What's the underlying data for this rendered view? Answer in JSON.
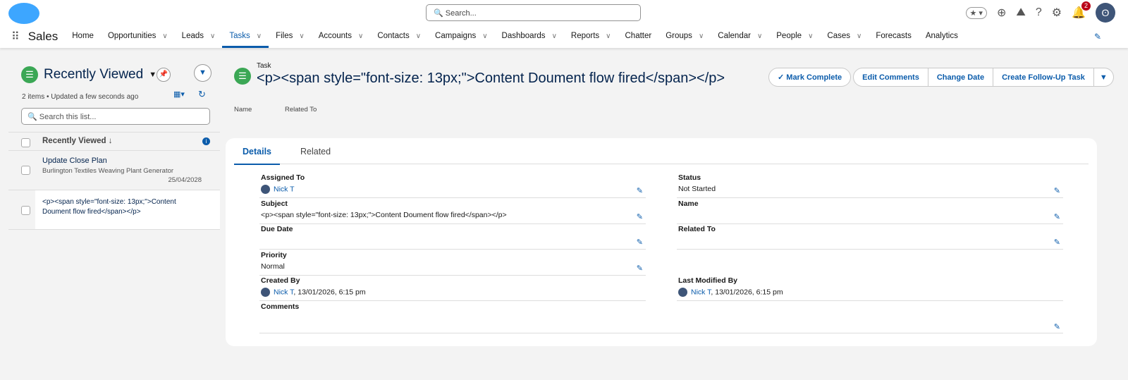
{
  "header": {
    "search_placeholder": "Search...",
    "notification_count": "2"
  },
  "nav": {
    "app_name": "Sales",
    "items": [
      {
        "label": "Home",
        "dropdown": false
      },
      {
        "label": "Opportunities",
        "dropdown": true
      },
      {
        "label": "Leads",
        "dropdown": true
      },
      {
        "label": "Tasks",
        "dropdown": true,
        "active": true
      },
      {
        "label": "Files",
        "dropdown": true
      },
      {
        "label": "Accounts",
        "dropdown": true
      },
      {
        "label": "Contacts",
        "dropdown": true
      },
      {
        "label": "Campaigns",
        "dropdown": true
      },
      {
        "label": "Dashboards",
        "dropdown": true
      },
      {
        "label": "Reports",
        "dropdown": true
      },
      {
        "label": "Chatter",
        "dropdown": false
      },
      {
        "label": "Groups",
        "dropdown": true
      },
      {
        "label": "Calendar",
        "dropdown": true
      },
      {
        "label": "People",
        "dropdown": true
      },
      {
        "label": "Cases",
        "dropdown": true
      },
      {
        "label": "Forecasts",
        "dropdown": false
      },
      {
        "label": "Analytics",
        "dropdown": false
      }
    ]
  },
  "list": {
    "title": "Recently Viewed",
    "meta": "2 items • Updated a few seconds ago",
    "search_placeholder": "Search this list...",
    "column": "Recently Viewed",
    "rows": [
      {
        "title": "Update Close Plan",
        "sub": "Burlington Textiles Weaving Plant Generator",
        "date": "25/04/2028"
      },
      {
        "title": "<p><span style=\"font-size: 13px;\">Content Doument flow fired</span></p>"
      }
    ]
  },
  "record": {
    "object": "Task",
    "title": "<p><span style=\"font-size: 13px;\">Content Doument flow fired</span></p>",
    "highlights": [
      "Name",
      "Related To"
    ],
    "actions": {
      "mark_complete": "Mark Complete",
      "edit_comments": "Edit Comments",
      "change_date": "Change Date",
      "follow_up": "Create Follow-Up Task"
    },
    "tabs": [
      "Details",
      "Related"
    ],
    "fields": {
      "assigned_to": {
        "label": "Assigned To",
        "value": "Nick T"
      },
      "status": {
        "label": "Status",
        "value": "Not Started"
      },
      "subject": {
        "label": "Subject",
        "value": "<p><span style=\"font-size: 13px;\">Content Doument flow fired</span></p>"
      },
      "name": {
        "label": "Name",
        "value": ""
      },
      "due_date": {
        "label": "Due Date",
        "value": ""
      },
      "related_to": {
        "label": "Related To",
        "value": ""
      },
      "priority": {
        "label": "Priority",
        "value": "Normal"
      },
      "created_by": {
        "label": "Created By",
        "user": "Nick T",
        "date": ", 13/01/2026, 6:15 pm"
      },
      "modified_by": {
        "label": "Last Modified By",
        "user": "Nick T",
        "date": ", 13/01/2026, 6:15 pm"
      },
      "comments": {
        "label": "Comments",
        "value": ""
      }
    }
  }
}
